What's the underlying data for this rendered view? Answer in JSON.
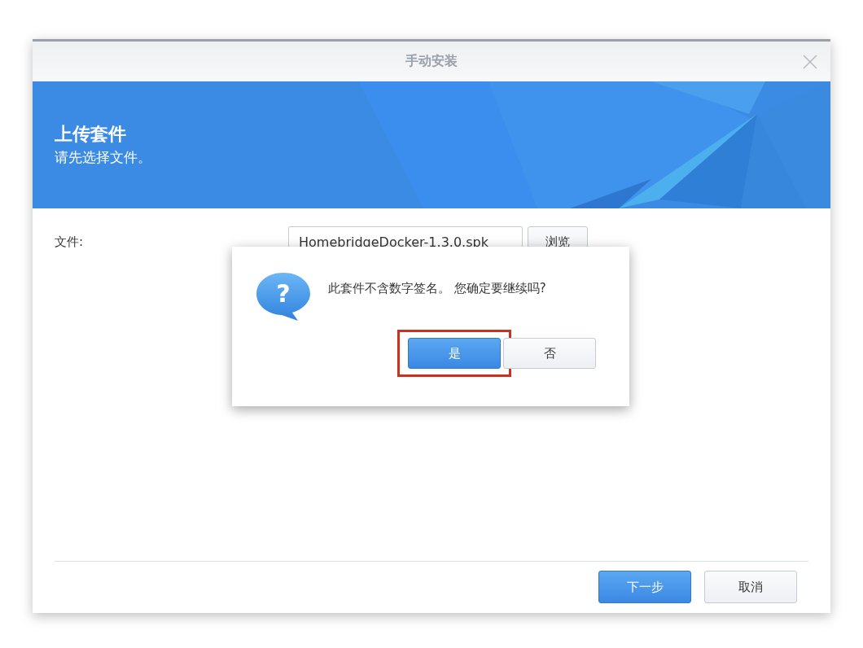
{
  "window": {
    "title": "手动安装"
  },
  "banner": {
    "title": "上传套件",
    "subtitle": "请先选择文件。"
  },
  "file_row": {
    "label": "文件:",
    "value": "HomebridgeDocker-1.3.0.spk",
    "browse_button": "浏览"
  },
  "dialog": {
    "icon": "?",
    "message": "此套件不含数字签名。 您确定要继续吗?",
    "buttons": [
      {
        "label": "是",
        "kind": "primary",
        "highlighted": true
      },
      {
        "label": "否",
        "kind": "secondary",
        "highlighted": false
      }
    ]
  },
  "footer": {
    "buttons": [
      {
        "label": "下一步",
        "kind": "primary"
      },
      {
        "label": "取消",
        "kind": "secondary"
      }
    ]
  }
}
